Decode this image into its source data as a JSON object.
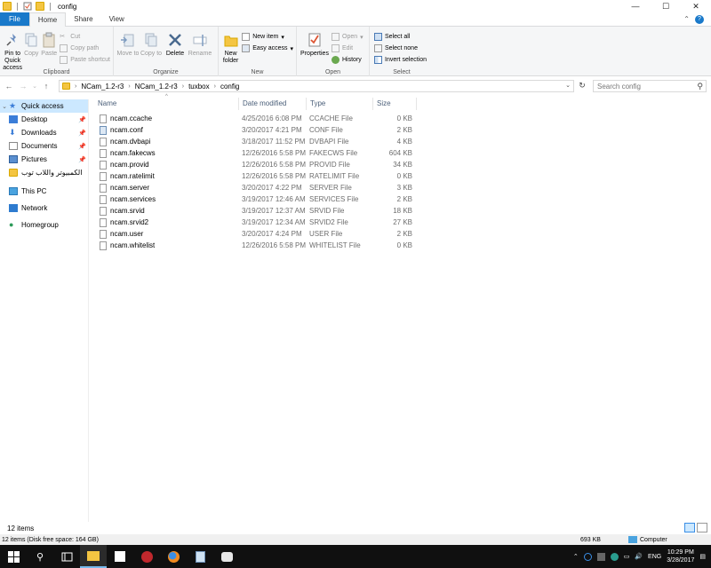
{
  "window": {
    "title": "config",
    "controls": {
      "minimize": "—",
      "maximize": "☐",
      "close": "✕"
    }
  },
  "ribbon_tabs": [
    {
      "label": "File"
    },
    {
      "label": "Home"
    },
    {
      "label": "Share"
    },
    {
      "label": "View"
    }
  ],
  "ribbon": {
    "clipboard": {
      "label": "Clipboard",
      "pin_quick_access": "Pin to Quick access",
      "copy": "Copy",
      "paste": "Paste",
      "cut": "Cut",
      "copy_path": "Copy path",
      "paste_shortcut": "Paste shortcut"
    },
    "organize": {
      "label": "Organize",
      "move_to": "Move to",
      "copy_to": "Copy to",
      "delete": "Delete",
      "rename": "Rename"
    },
    "new": {
      "label": "New",
      "new_folder": "New folder",
      "new_item": "New item",
      "easy_access": "Easy access"
    },
    "open": {
      "label": "Open",
      "properties": "Properties",
      "open": "Open",
      "edit": "Edit",
      "history": "History"
    },
    "select": {
      "label": "Select",
      "select_all": "Select all",
      "select_none": "Select none",
      "invert_selection": "Invert selection"
    }
  },
  "address": {
    "crumbs": [
      "NCam_1.2-r3",
      "NCam_1.2-r3",
      "tuxbox",
      "config"
    ],
    "search_placeholder": "Search config"
  },
  "nav": {
    "quick_access": "Quick access",
    "items": [
      {
        "label": "Desktop"
      },
      {
        "label": "Downloads"
      },
      {
        "label": "Documents"
      },
      {
        "label": "Pictures"
      },
      {
        "label": "الكمبيوتر واللاب توب"
      }
    ],
    "this_pc": "This PC",
    "network": "Network",
    "homegroup": "Homegroup"
  },
  "columns": {
    "name": "Name",
    "date": "Date modified",
    "type": "Type",
    "size": "Size"
  },
  "files": [
    {
      "name": "ncam.ccache",
      "date": "4/25/2016 6:08 PM",
      "type": "CCACHE File",
      "size": "0 KB"
    },
    {
      "name": "ncam.conf",
      "date": "3/20/2017 4:21 PM",
      "type": "CONF File",
      "size": "2 KB"
    },
    {
      "name": "ncam.dvbapi",
      "date": "3/18/2017 11:52 PM",
      "type": "DVBAPI File",
      "size": "4 KB"
    },
    {
      "name": "ncam.fakecws",
      "date": "12/26/2016 5:58 PM",
      "type": "FAKECWS File",
      "size": "604 KB"
    },
    {
      "name": "ncam.provid",
      "date": "12/26/2016 5:58 PM",
      "type": "PROVID File",
      "size": "34 KB"
    },
    {
      "name": "ncam.ratelimit",
      "date": "12/26/2016 5:58 PM",
      "type": "RATELIMIT File",
      "size": "0 KB"
    },
    {
      "name": "ncam.server",
      "date": "3/20/2017 4:22 PM",
      "type": "SERVER File",
      "size": "3 KB"
    },
    {
      "name": "ncam.services",
      "date": "3/19/2017 12:46 AM",
      "type": "SERVICES File",
      "size": "2 KB"
    },
    {
      "name": "ncam.srvid",
      "date": "3/19/2017 12:37 AM",
      "type": "SRVID File",
      "size": "18 KB"
    },
    {
      "name": "ncam.srvid2",
      "date": "3/19/2017 12:34 AM",
      "type": "SRVID2 File",
      "size": "27 KB"
    },
    {
      "name": "ncam.user",
      "date": "3/20/2017 4:24 PM",
      "type": "USER File",
      "size": "2 KB"
    },
    {
      "name": "ncam.whitelist",
      "date": "12/26/2016 5:58 PM",
      "type": "WHITELIST File",
      "size": "0 KB"
    }
  ],
  "status": {
    "item_count": "12 items"
  },
  "details": {
    "left": "12 items (Disk free space: 164 GB)",
    "size": "693 KB",
    "location": "Computer"
  },
  "taskbar": {
    "language": "ENG",
    "time": "10:29 PM",
    "date": "3/28/2017"
  },
  "colors": {
    "accent": "#1979ca",
    "selection": "#cce8ff",
    "taskbar": "#101010"
  }
}
